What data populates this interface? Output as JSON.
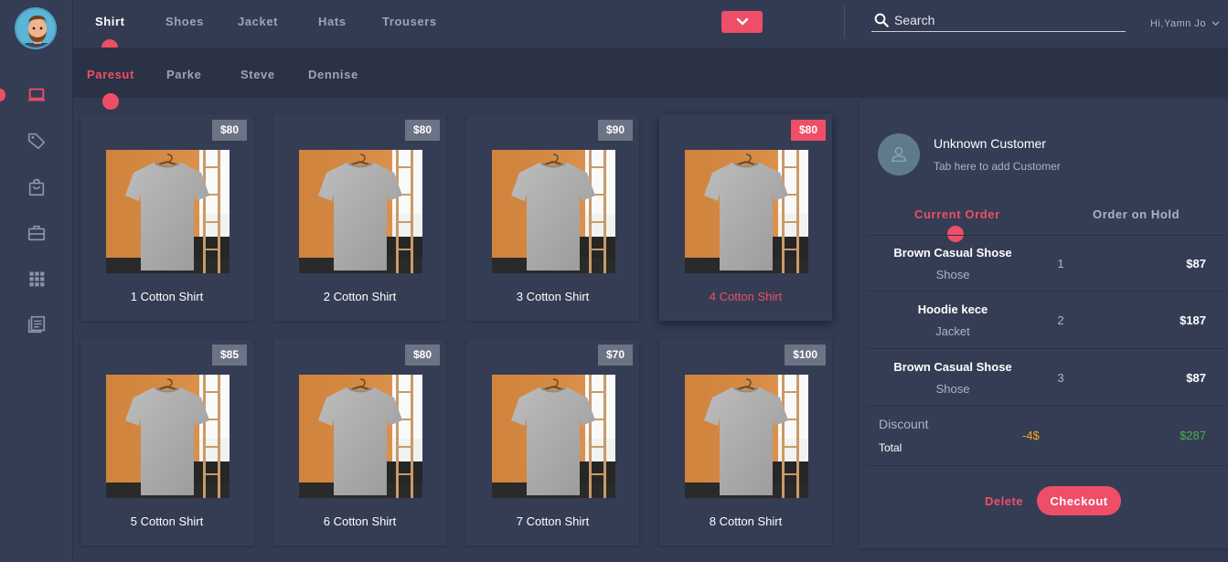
{
  "user": {
    "greeting": "Hi,Yamn Jo"
  },
  "top_tabs": [
    {
      "label": "Shirt",
      "active": true
    },
    {
      "label": "Shoes",
      "active": false
    },
    {
      "label": "Jacket",
      "active": false
    },
    {
      "label": "Hats",
      "active": false
    },
    {
      "label": "Trousers",
      "active": false
    }
  ],
  "sub_tabs": [
    {
      "label": "Paresut",
      "active": true
    },
    {
      "label": "Parke",
      "active": false
    },
    {
      "label": "Steve",
      "active": false
    },
    {
      "label": "Dennise",
      "active": false
    }
  ],
  "search": {
    "placeholder": "Search"
  },
  "sidebar": {
    "items": [
      {
        "icon": "laptop-icon",
        "active": true
      },
      {
        "icon": "tag-icon",
        "active": false
      },
      {
        "icon": "shopping-bag-icon",
        "active": false
      },
      {
        "icon": "briefcase-icon",
        "active": false
      },
      {
        "icon": "grid-icon",
        "active": false
      },
      {
        "icon": "document-icon",
        "active": false
      }
    ]
  },
  "products": [
    {
      "name": "1 Cotton Shirt",
      "price": "$80",
      "selected": false
    },
    {
      "name": "2 Cotton Shirt",
      "price": "$80",
      "selected": false
    },
    {
      "name": "3 Cotton Shirt",
      "price": "$90",
      "selected": false
    },
    {
      "name": "4 Cotton Shirt",
      "price": "$80",
      "selected": true
    },
    {
      "name": "5 Cotton Shirt",
      "price": "$85",
      "selected": false
    },
    {
      "name": "6 Cotton Shirt",
      "price": "$80",
      "selected": false
    },
    {
      "name": "7 Cotton Shirt",
      "price": "$70",
      "selected": false
    },
    {
      "name": "8 Cotton Shirt",
      "price": "$100",
      "selected": false
    }
  ],
  "order": {
    "customer_name": "Unknown Customer",
    "customer_hint": "Tab here to add Customer",
    "tabs": [
      {
        "label": "Current Order",
        "active": true
      },
      {
        "label": "Order on Hold",
        "active": false
      }
    ],
    "items": [
      {
        "name": "Brown Casual Shose",
        "category": "Shose",
        "qty": "1",
        "price": "$87"
      },
      {
        "name": "Hoodie kece",
        "category": "Jacket",
        "qty": "2",
        "price": "$187"
      },
      {
        "name": "Brown Casual Shose",
        "category": "Shose",
        "qty": "3",
        "price": "$87"
      }
    ],
    "discount_label": "Discount",
    "discount_value": "-4$",
    "total_label": "Total",
    "total_value": "$287",
    "delete_label": "Delete",
    "checkout_label": "Checkout"
  },
  "colors": {
    "accent": "#ee4e67",
    "background": "#323b52",
    "card": "#343d54",
    "discount": "#f5a623",
    "total": "#4caf50"
  }
}
